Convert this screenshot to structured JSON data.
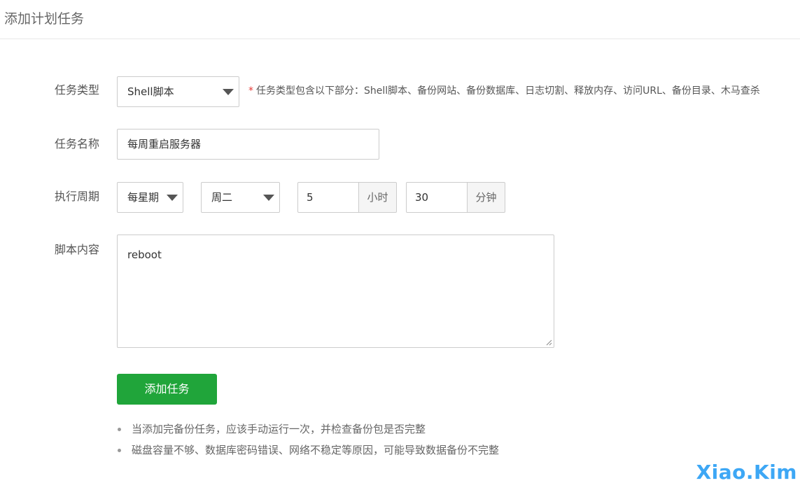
{
  "header": {
    "title": "添加计划任务"
  },
  "form": {
    "task_type": {
      "label": "任务类型",
      "selected": "Shell脚本",
      "hint_star": "*",
      "hint": "任务类型包含以下部分：Shell脚本、备份网站、备份数据库、日志切割、释放内存、访问URL、备份目录、木马查杀"
    },
    "task_name": {
      "label": "任务名称",
      "value": "每周重启服务器"
    },
    "schedule": {
      "label": "执行周期",
      "period_selected": "每星期",
      "weekday_selected": "周二",
      "hour_value": "5",
      "hour_unit": "小时",
      "minute_value": "30",
      "minute_unit": "分钟"
    },
    "script": {
      "label": "脚本内容",
      "value": "reboot"
    },
    "submit_label": "添加任务"
  },
  "notes": [
    "当添加完备份任务，应该手动运行一次，并检查备份包是否完整",
    "磁盘容量不够、数据库密码错误、网络不稳定等原因，可能导致数据备份不完整"
  ],
  "watermark": "Xiao.Kim",
  "colors": {
    "accent_green": "#20a53a",
    "required_red": "#e53935",
    "watermark_blue": "#3da7f5"
  }
}
